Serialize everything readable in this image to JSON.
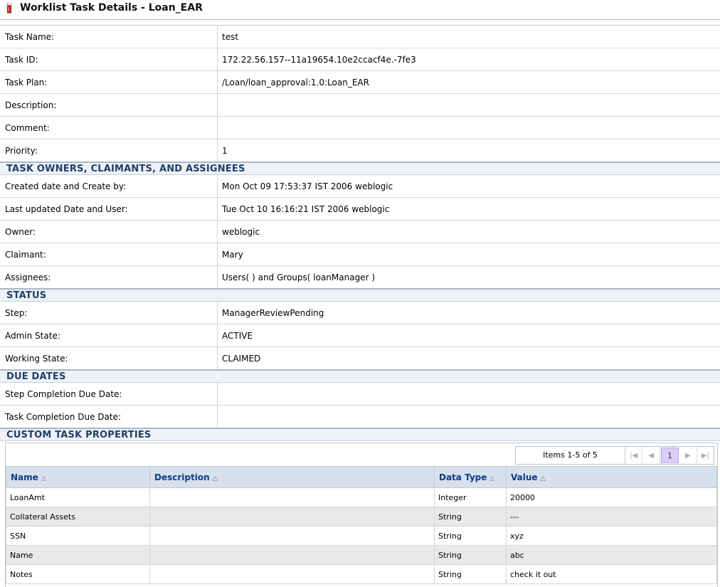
{
  "header": {
    "title": "Worklist Task Details - Loan_EAR",
    "icon": "flashlight-icon"
  },
  "task": {
    "name_label": "Task Name:",
    "name_value": "test",
    "id_label": "Task ID:",
    "id_value": "172.22.56.157--11a19654.10e2ccacf4e.-7fe3",
    "plan_label": "Task Plan:",
    "plan_value": "/Loan/loan_approval:1.0:Loan_EAR",
    "description_label": "Description:",
    "description_value": "",
    "comment_label": "Comment:",
    "comment_value": "",
    "priority_label": "Priority:",
    "priority_value": "1"
  },
  "owners": {
    "section_title": "TASK OWNERS, CLAIMANTS, AND ASSIGNEES",
    "created_label": "Created date and Create by:",
    "created_value": "Mon Oct 09 17:53:37 IST 2006 weblogic",
    "updated_label": "Last updated Date and User:",
    "updated_value": "Tue Oct 10 16:16:21 IST 2006 weblogic",
    "owner_label": "Owner:",
    "owner_value": "weblogic",
    "claimant_label": "Claimant:",
    "claimant_value": "Mary",
    "assignees_label": "Assignees:",
    "assignees_value": "Users( ) and Groups( loanManager )"
  },
  "status": {
    "section_title": "STATUS",
    "step_label": "Step:",
    "step_value": "ManagerReviewPending",
    "admin_label": "Admin State:",
    "admin_value": "ACTIVE",
    "working_label": "Working State:",
    "working_value": "CLAIMED"
  },
  "due": {
    "section_title": "DUE DATES",
    "step_due_label": "Step Completion Due Date:",
    "step_due_value": "",
    "task_due_label": "Task Completion Due Date:",
    "task_due_value": ""
  },
  "custom": {
    "section_title": "CUSTOM TASK PROPERTIES",
    "pager": {
      "info": "Items 1-5 of 5",
      "page": "1"
    },
    "columns": {
      "name": "Name",
      "description": "Description",
      "data_type": "Data Type",
      "value": "Value"
    },
    "rows": [
      {
        "name": "LoanAmt",
        "description": "",
        "data_type": "Integer",
        "value": "20000"
      },
      {
        "name": "Collateral Assets",
        "description": "",
        "data_type": "String",
        "value": "---"
      },
      {
        "name": "SSN",
        "description": "",
        "data_type": "String",
        "value": "xyz"
      },
      {
        "name": "Name",
        "description": "",
        "data_type": "String",
        "value": "abc"
      },
      {
        "name": "Notes",
        "description": "",
        "data_type": "String",
        "value": "check it out"
      }
    ]
  }
}
